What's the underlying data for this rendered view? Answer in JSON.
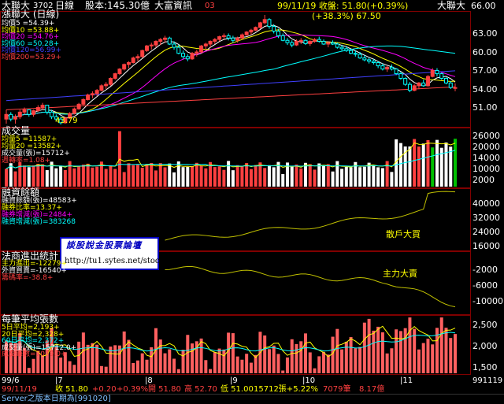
{
  "header": {
    "stock_name": "大聯大",
    "stock_code": "3702",
    "period": "日線",
    "capital": "股本:145.30億",
    "vendor": "大富資訊",
    "month": "03",
    "date_close": "99/11/19 收盤: 51.80(+0.39%)",
    "name_right": "大聯大",
    "price_top": "66.00"
  },
  "price_panel": {
    "title": "漲聯大 (日線)",
    "legend": [
      {
        "label": "均價5 =54.39+",
        "color": "#ffffff"
      },
      {
        "label": "均價10 =53.88+",
        "color": "#ffff00"
      },
      {
        "label": "均價20 =54.76+",
        "color": "#ff00ff"
      },
      {
        "label": "均價60 =50.28+",
        "color": "#00ffff"
      },
      {
        "label": "均價120=56.99+",
        "color": "#4040ff"
      },
      {
        "label": "均價200=53.29+",
        "color": "#ff4040"
      }
    ],
    "peak_label": "(+38.3%) 67.50",
    "low_label": "43.79",
    "axis": [
      "63.00",
      "60.00",
      "57.00",
      "54.00",
      "51.00"
    ]
  },
  "volume_panel": {
    "title": "成交量",
    "legend": [
      {
        "label": "均量5 =11587+",
        "color": "#ffff00"
      },
      {
        "label": "均量20 =13582+",
        "color": "#ffff00"
      },
      {
        "label": "成交量(張)=15712+",
        "color": "#ffffff"
      },
      {
        "label": "週轉率=1.08+",
        "color": "#ff4040"
      }
    ],
    "axis": [
      "26000",
      "20000",
      "14000",
      "10000",
      "2000"
    ]
  },
  "margin_panel": {
    "title": "融資餘額",
    "legend": [
      {
        "label": "融資餘額(張)=48583+",
        "color": "#ffffff"
      },
      {
        "label": "融券比率=13.37+",
        "color": "#ffff00"
      },
      {
        "label": "融券增減(張)=2484+",
        "color": "#ff00ff"
      },
      {
        "label": "融資增減(張)=383268",
        "color": "#00ffff"
      }
    ],
    "annotation": "散戶大買",
    "axis": [
      "40000",
      "32000",
      "24000",
      "16000"
    ]
  },
  "institution_panel": {
    "title": "法商進出統計",
    "legend": [
      {
        "label": "主力進出=-12279+",
        "color": "#ffff00"
      },
      {
        "label": "外資買賣=-16540+",
        "color": "#ffffff"
      },
      {
        "label": "籌碼率=-38.8+",
        "color": "#ff4040"
      }
    ],
    "annotation": "主力大賣",
    "axis": [
      "-2000",
      "-6000",
      "-10000"
    ]
  },
  "avg_panel": {
    "title": "每筆平均張數",
    "legend": [
      {
        "label": "5日平均=2,193+",
        "color": "#ffff00"
      },
      {
        "label": "20日平均=2,328+",
        "color": "#ffff00"
      },
      {
        "label": "60日平均=2,372+",
        "color": "#00ffff"
      },
      {
        "label": "成交量(張)=15712.0+",
        "color": "#ffffff"
      },
      {
        "label": "成交筆數=7079.0+",
        "color": "#ff4040"
      }
    ],
    "axis": [
      "2,500",
      "2,000",
      "1,500"
    ]
  },
  "months": [
    "99/6",
    "|7",
    "|8",
    "|9",
    "|10",
    "|11"
  ],
  "date_range_right": "991119",
  "status_bar": {
    "date": "99/11/19",
    "close": "收 51.80",
    "change": "+0.20",
    "pct": "+0.39%",
    "open": "開 51.80",
    "high": "高 52.70",
    "low": "低 51.00",
    "volume": "15712張+5.22%",
    "trades": "7079筆",
    "avg": "8.17億"
  },
  "footer": "Server之版本日期為[991020]",
  "watermark": {
    "title": "談股說金股票論壇",
    "url": "http://tu1.sytes.net/stock"
  },
  "chart_data": {
    "type": "candlestick",
    "candles_ohlc": [
      [
        45,
        47,
        44,
        46
      ],
      [
        46,
        46.5,
        44.5,
        45
      ],
      [
        45,
        46,
        44,
        45.5
      ],
      [
        45.5,
        47,
        45,
        46.5
      ],
      [
        46.5,
        47.5,
        46,
        47
      ],
      [
        47,
        47,
        45.5,
        46
      ],
      [
        46,
        47,
        45.5,
        46.8
      ],
      [
        46.8,
        48,
        46.5,
        47.5
      ],
      [
        47.5,
        48.5,
        47,
        48
      ],
      [
        48,
        48,
        46,
        46.5
      ],
      [
        46.5,
        47,
        45,
        45.5
      ],
      [
        45.5,
        46,
        44.5,
        45
      ],
      [
        45,
        45.5,
        43.8,
        44.2
      ],
      [
        44.2,
        45.5,
        44,
        45.2
      ],
      [
        45.2,
        46.5,
        45,
        46.2
      ],
      [
        46.2,
        47.5,
        46,
        47.2
      ],
      [
        47.2,
        48.5,
        47,
        48.2
      ],
      [
        48.2,
        49.5,
        48,
        49.2
      ],
      [
        49.2,
        50.5,
        49,
        50.2
      ],
      [
        50.2,
        51,
        49.5,
        50.5
      ],
      [
        50.5,
        51.5,
        50,
        51.2
      ],
      [
        51.2,
        52.5,
        51,
        52.2
      ],
      [
        52.2,
        53,
        51.5,
        52.5
      ],
      [
        52.5,
        54,
        52.2,
        53.8
      ],
      [
        53.8,
        55,
        53.5,
        54.8
      ],
      [
        54.8,
        56,
        54.5,
        55.8
      ],
      [
        55.8,
        57,
        55.5,
        56.8
      ],
      [
        56.8,
        57.5,
        56,
        57.2
      ],
      [
        57.2,
        58.5,
        57,
        58.2
      ],
      [
        58.2,
        59,
        57.5,
        58.5
      ],
      [
        58.5,
        60,
        58.2,
        59.8
      ],
      [
        59.8,
        61,
        59.5,
        60.8
      ],
      [
        60.8,
        61.5,
        60,
        61
      ],
      [
        61,
        62,
        60.5,
        61.8
      ],
      [
        61.8,
        62.5,
        61,
        62.2
      ],
      [
        62.2,
        63,
        61.5,
        62.5
      ],
      [
        62.5,
        62.8,
        61,
        61.2
      ],
      [
        61.2,
        61.8,
        60,
        60.5
      ],
      [
        60.5,
        61,
        59,
        59.2
      ],
      [
        59.2,
        59.8,
        58,
        58.5
      ],
      [
        58.5,
        59,
        57.5,
        58
      ],
      [
        58,
        59.5,
        57.8,
        59.2
      ],
      [
        59.2,
        60,
        58.5,
        59.5
      ],
      [
        59.5,
        61,
        59.2,
        60.8
      ],
      [
        60.8,
        61.5,
        60,
        61.2
      ],
      [
        61.2,
        62,
        60.5,
        61.8
      ],
      [
        61.8,
        62.5,
        61.2,
        62.2
      ],
      [
        62.2,
        63,
        61.8,
        62.8
      ],
      [
        62.8,
        63.5,
        62.2,
        63
      ],
      [
        63,
        63.5,
        62,
        62.5
      ],
      [
        62.5,
        63,
        61.5,
        62
      ],
      [
        62,
        62.8,
        61.5,
        62.5
      ],
      [
        62.5,
        63.5,
        62.2,
        63.2
      ],
      [
        63.2,
        64,
        63,
        63.8
      ],
      [
        63.8,
        64.5,
        63.2,
        64.2
      ],
      [
        64.2,
        65,
        64,
        64.8
      ],
      [
        64.8,
        66,
        64.5,
        65.8
      ],
      [
        65.8,
        67.5,
        65.5,
        66.5
      ],
      [
        66.5,
        66.8,
        64.5,
        65
      ],
      [
        65,
        65.5,
        63.5,
        64
      ],
      [
        64,
        64.5,
        62.5,
        63
      ],
      [
        63,
        63.5,
        61.8,
        62
      ],
      [
        62,
        62.5,
        61,
        61.5
      ],
      [
        61.5,
        62,
        60.5,
        61
      ],
      [
        61,
        62.2,
        60.8,
        61.8
      ],
      [
        61.8,
        62.5,
        61.2,
        62
      ],
      [
        62,
        62.2,
        61,
        61.3
      ],
      [
        61.3,
        62,
        60.8,
        61.8
      ],
      [
        61.8,
        62.5,
        61.5,
        62.2
      ],
      [
        62.2,
        62.8,
        61.5,
        61.8
      ],
      [
        61.8,
        62.2,
        61,
        61.2
      ],
      [
        61.2,
        61.8,
        60.5,
        61.5
      ],
      [
        61.5,
        62,
        61,
        61.2
      ],
      [
        61.2,
        61.5,
        60.2,
        60.5
      ],
      [
        60.5,
        61,
        59.8,
        60.2
      ],
      [
        60.2,
        60.8,
        59.5,
        59.8
      ],
      [
        59.8,
        60.2,
        59,
        59.2
      ],
      [
        59.2,
        59.8,
        58.5,
        59
      ],
      [
        59,
        59.5,
        58,
        58.2
      ],
      [
        58.2,
        58.8,
        57.5,
        57.8
      ],
      [
        57.8,
        58.2,
        57,
        57.5
      ],
      [
        57.5,
        58,
        56.8,
        57.2
      ],
      [
        57.2,
        57.5,
        56,
        56.5
      ],
      [
        56.5,
        57,
        55.5,
        55.8
      ],
      [
        55.8,
        56.5,
        55.2,
        56.2
      ],
      [
        56.2,
        56.8,
        55.5,
        55.8
      ],
      [
        55.8,
        56,
        54.5,
        54.8
      ],
      [
        54.8,
        55.2,
        53.5,
        53.8
      ],
      [
        53.8,
        54,
        52.2,
        52.5
      ],
      [
        52.5,
        53,
        50.8,
        51.2
      ],
      [
        51.2,
        52.5,
        51,
        52.2
      ],
      [
        52.2,
        53,
        51.5,
        52.8
      ],
      [
        52.8,
        53.5,
        52,
        52.2
      ],
      [
        52.2,
        54.5,
        52,
        54.2
      ],
      [
        54.2,
        56,
        54,
        55.5
      ],
      [
        55.5,
        56,
        54.2,
        54.8
      ],
      [
        54.8,
        55,
        53.5,
        53.8
      ],
      [
        53.8,
        54,
        52.5,
        52.8
      ],
      [
        52.8,
        53.2,
        51.5,
        51.8
      ],
      [
        51.8,
        52.7,
        51,
        51.8
      ]
    ],
    "price_range": [
      43.5,
      68
    ],
    "volume_range": [
      0,
      29000
    ],
    "margin_range": [
      13000,
      46000
    ],
    "institution_range": [
      -12000,
      2500
    ],
    "avg_range": [
      1450,
      2750
    ]
  }
}
